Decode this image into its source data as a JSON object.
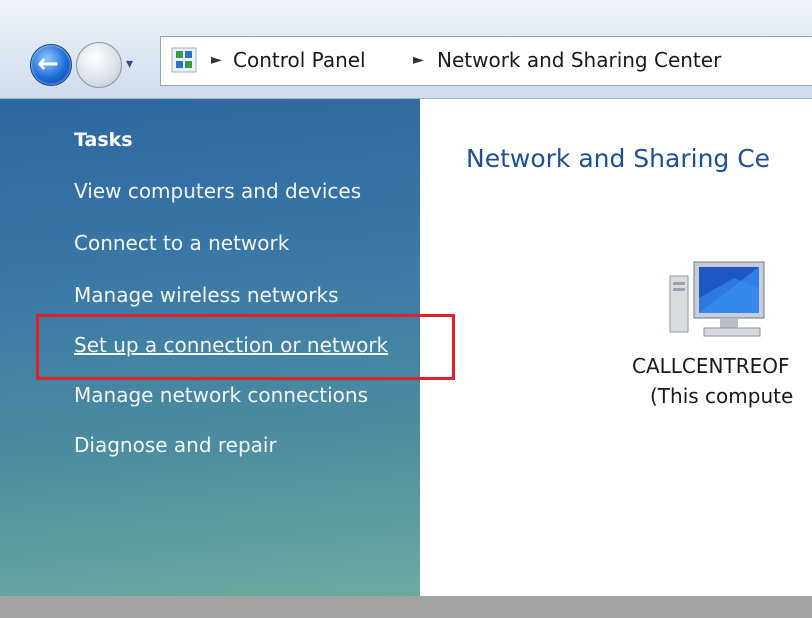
{
  "navigation": {
    "back_icon": "back-arrow-icon",
    "forward_icon": "forward-arrow-icon",
    "dropdown_icon": "chevron-down-icon"
  },
  "address_bar": {
    "icon": "control-panel-icon",
    "crumbs": [
      "Control Panel",
      "Network and Sharing Center"
    ]
  },
  "sidebar": {
    "title": "Tasks",
    "items": [
      {
        "label": "View computers and devices"
      },
      {
        "label": "Connect to a network"
      },
      {
        "label": "Manage wireless networks"
      },
      {
        "label": "Set up a connection or network",
        "highlighted": true
      },
      {
        "label": "Manage network connections"
      },
      {
        "label": "Diagnose and repair"
      }
    ]
  },
  "content": {
    "title": "Network and Sharing Ce",
    "computer": {
      "icon": "computer-icon",
      "name": "CALLCENTREOF",
      "subtitle": "(This compute"
    }
  },
  "colors": {
    "sidebar": "#3a78a6",
    "highlight_box": "#e0232b",
    "title_blue": "#1d4f91"
  }
}
